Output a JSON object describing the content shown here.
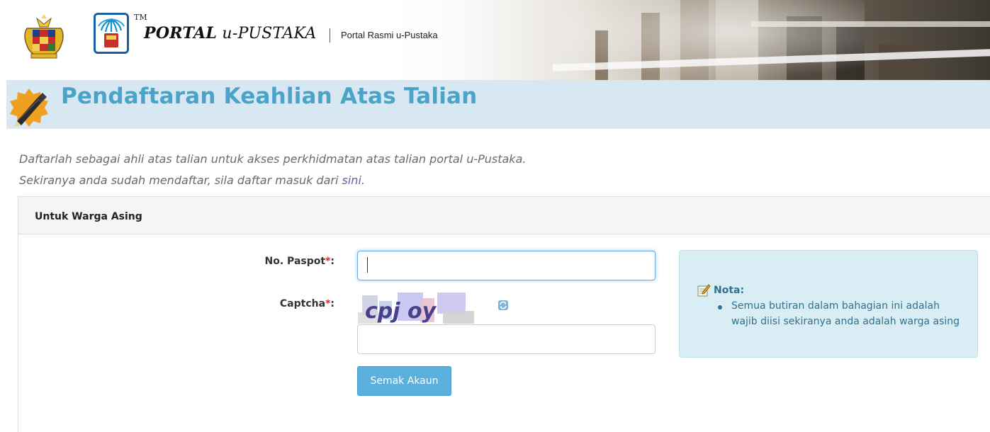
{
  "header": {
    "tm": "TM",
    "title_prefix": "PORTAL",
    "title_suffix": "u-PUSTAKA",
    "subtitle": "Portal Rasmi u-Pustaka"
  },
  "page": {
    "title": "Pendaftaran Keahlian Atas Talian",
    "intro_line1": "Daftarlah sebagai ahli atas talian untuk akses perkhidmatan atas talian portal u-Pustaka.",
    "intro_line2_prefix": "Sekiranya anda sudah mendaftar, sila daftar masuk dari ",
    "intro_link": "sini",
    "intro_line2_suffix": "."
  },
  "panel": {
    "heading": "Untuk Warga Asing",
    "passport_label": "No. Paspot",
    "passport_value": "",
    "captcha_label": "Captcha",
    "required_mark": "*",
    "label_colon": ":",
    "captcha_text": "cpj oy",
    "captcha_value": "",
    "submit_label": "Semak Akaun"
  },
  "note": {
    "title": "Nota:",
    "items": [
      "Semua butiran dalam bahagian ini adalah wajib diisi sekiranya anda adalah warga asing"
    ]
  },
  "colors": {
    "accent": "#4aa3c9",
    "title_bar": "#d7e8f2",
    "button": "#5bb0de",
    "note_bg": "#d9eef4",
    "note_text": "#31708f",
    "required": "#c9302c"
  },
  "icons": {
    "crest": "malaysia-crest-icon",
    "logo": "u-pustaka-logo-icon",
    "title": "pencil-badge-icon",
    "refresh": "refresh-icon",
    "note": "notepad-icon"
  }
}
